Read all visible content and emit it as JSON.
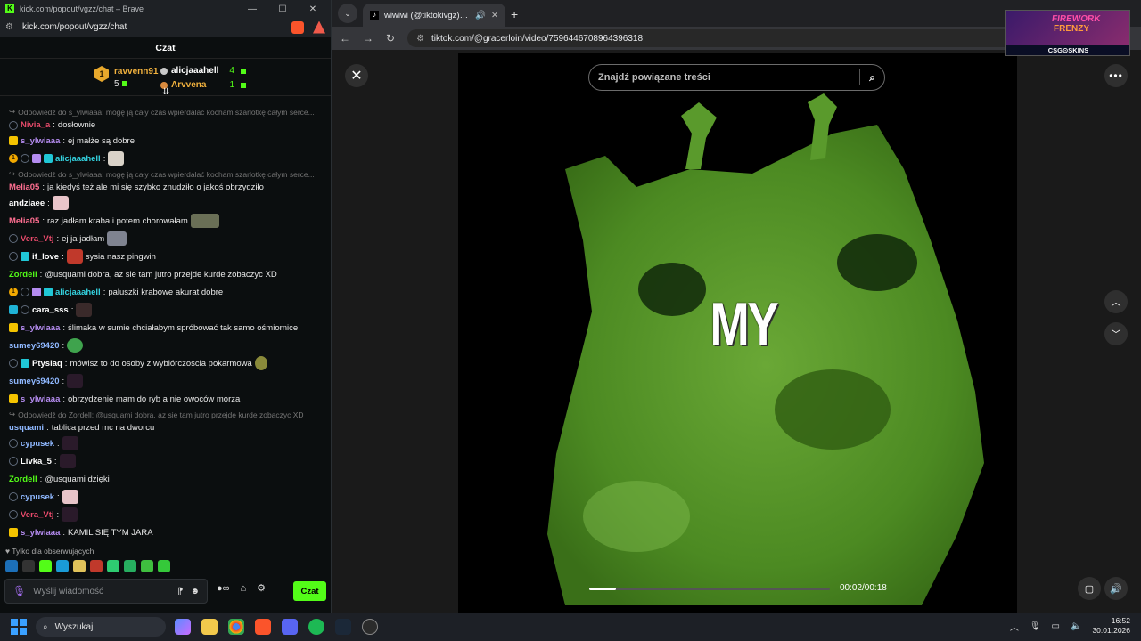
{
  "kick": {
    "window_title": "kick.com/popout/vgzz/chat – Brave",
    "url": "kick.com/popout/vgzz/chat",
    "chat_header": "Czat",
    "gift_leaders": [
      {
        "rank": "1",
        "name": "ravvenn91",
        "count": "5"
      },
      {
        "name": "alicjaaahell",
        "count": "4"
      },
      {
        "name": "Arvvena",
        "count": "1"
      }
    ],
    "messages": [
      {
        "type": "reply",
        "text": "Odpowiedź do s_ylwiaaa: mogę ją cały czas wpierdalać kocham szarlotkę całym serce..."
      },
      {
        "user": "Nivia_a",
        "color": "#e64a6a",
        "text": "dosłownie"
      },
      {
        "user": "s_ylwiaaa",
        "color": "#b58cf0",
        "text": "ej małże są dobre"
      },
      {
        "user": "alicjaaahell",
        "color": "#34d3e0",
        "text": ""
      },
      {
        "type": "reply",
        "text": "Odpowiedź do s_ylwiaaa: mogę ją cały czas wpierdalać kocham szarlotkę całym serce..."
      },
      {
        "user": "Melia05",
        "color": "#ff6f91",
        "text": "ja kiedyś też ale mi się szybko znudziło o jakoś obrzydziło"
      },
      {
        "user": "andziaee",
        "color": "#ffffff",
        "text": ""
      },
      {
        "user": "Melia05",
        "color": "#ff6f91",
        "text": "raz jadłam kraba i potem chorowałam"
      },
      {
        "user": "Vera_Vtj",
        "color": "#e64a6a",
        "text": "ej ja jadłam"
      },
      {
        "user": "if_love",
        "color": "#ffffff",
        "text": "sysia nasz pingwin"
      },
      {
        "user": "Zordell",
        "color": "#53fc18",
        "text": "@usquami dobra, az sie tam jutro przejde kurde zobaczyc XD"
      },
      {
        "user": "alicjaaahell",
        "color": "#34d3e0",
        "text": "paluszki krabowe akurat dobre"
      },
      {
        "user": "cara_sss",
        "color": "#ffffff",
        "text": ""
      },
      {
        "user": "s_ylwiaaa",
        "color": "#b58cf0",
        "text": "ślimaka w sumie chciałabym spróbować tak samo ośmiornice"
      },
      {
        "user": "sumey69420",
        "color": "#8fb8ff",
        "text": ""
      },
      {
        "user": "Ptysiaq",
        "color": "#ffffff",
        "text": "mówisz to do osoby z wybiórczoscia pokarmowa"
      },
      {
        "user": "sumey69420",
        "color": "#8fb8ff",
        "text": ""
      },
      {
        "user": "s_ylwiaaa",
        "color": "#b58cf0",
        "text": "obrzydzenie mam do ryb a nie owoców morza"
      },
      {
        "type": "reply",
        "text": "Odpowiedź do Zordell: @usquami dobra, az sie tam jutro przejde kurde zobaczyc XD"
      },
      {
        "user": "usquami",
        "color": "#8fb8ff",
        "text": "tablica przed mc na dworcu"
      },
      {
        "user": "cypusek",
        "color": "#8fb8ff",
        "text": ""
      },
      {
        "user": "Livka_5",
        "color": "#ffffff",
        "text": ""
      },
      {
        "user": "Zordell",
        "color": "#53fc18",
        "text": "@usquami dzięki"
      },
      {
        "user": "cypusek",
        "color": "#8fb8ff",
        "text": ""
      },
      {
        "user": "Vera_Vtj",
        "color": "#e64a6a",
        "text": ""
      },
      {
        "user": "s_ylwiaaa",
        "color": "#b58cf0",
        "text": "KAMIL SIĘ TYM JARA"
      }
    ],
    "followers_only": "Tylko dla obserwujących",
    "input_placeholder": "Wyślij wiadomość",
    "send_label": "Czat"
  },
  "browser": {
    "tab_title": "wiwiwi (@tiktokivgz) | TikTok",
    "url": "tiktok.com/@gracerloin/video/7596446708964396318",
    "search_placeholder": "Znajdź powiązane treści",
    "caption": "MY",
    "timecode": "00:02/00:18",
    "progress": 0.11,
    "ad_line1": "FIREWORK",
    "ad_line2": "FRENZY",
    "ad_brand": "CSG⊙SKINS"
  },
  "taskbar": {
    "search": "Wyszukaj",
    "time": "16:52",
    "date": "30.01.2026"
  }
}
